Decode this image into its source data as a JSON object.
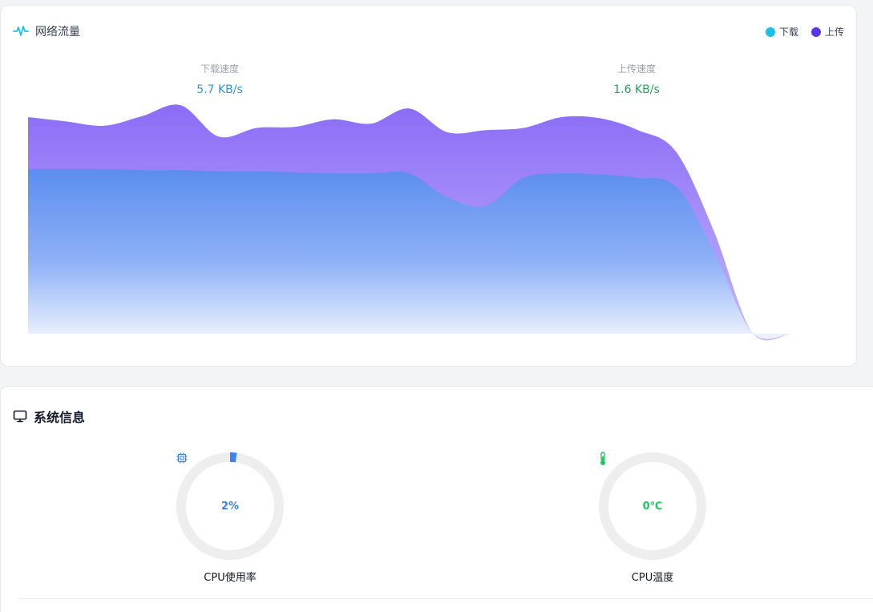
{
  "network": {
    "title": "网络流量",
    "title_icon": "activity-pulse-icon",
    "legend": [
      {
        "label": "下载",
        "color": "#1ec0ea"
      },
      {
        "label": "上传",
        "color": "#5b35e8"
      }
    ],
    "download": {
      "label": "下载速度",
      "value": "5.7 KB/s"
    },
    "upload": {
      "label": "上传速度",
      "value": "1.6 KB/s"
    }
  },
  "chart_data": {
    "type": "area",
    "title": "",
    "xlabel": "",
    "ylabel": "",
    "grid": false,
    "legend_position": "top-right",
    "ylim": [
      0,
      10
    ],
    "x": [
      0,
      1,
      2,
      3,
      4,
      5,
      6,
      7,
      8,
      9,
      10,
      11,
      12,
      13,
      14,
      15,
      16,
      17,
      18,
      19,
      20
    ],
    "series": [
      {
        "name": "下载",
        "color": "#5b8def",
        "values": [
          7.6,
          7.6,
          7.6,
          7.55,
          7.55,
          7.5,
          7.5,
          7.45,
          7.4,
          7.4,
          7.4,
          6.3,
          5.9,
          7.2,
          7.4,
          7.35,
          7.2,
          6.8,
          3.8,
          0.05,
          0
        ]
      },
      {
        "name": "上传",
        "color": "#8b6cf6",
        "values": [
          2.4,
          2.2,
          2.0,
          2.5,
          3.0,
          1.6,
          2.0,
          2.1,
          2.5,
          2.3,
          3.0,
          3.0,
          3.5,
          2.3,
          2.6,
          2.6,
          2.2,
          1.6,
          0.9,
          0,
          0
        ]
      }
    ]
  },
  "system": {
    "title": "系统信息",
    "title_icon": "monitor-icon",
    "gauges": [
      {
        "label": "CPU使用率",
        "value": "2%",
        "percent": 2,
        "icon": "cpu-chip-icon",
        "color": "#3b82f6"
      },
      {
        "label": "CPU温度",
        "value": "0℃",
        "percent": 0,
        "icon": "thermometer-icon",
        "color": "#22c55e"
      }
    ]
  }
}
